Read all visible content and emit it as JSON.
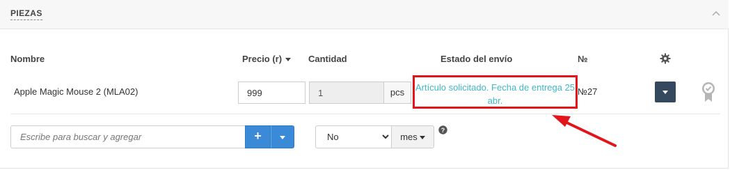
{
  "panel": {
    "title": "PIEZAS"
  },
  "table": {
    "headers": {
      "name": "Nombre",
      "price": "Precio (r)",
      "quantity": "Cantidad",
      "shipping_status": "Estado del envío",
      "number": "№"
    },
    "rows": [
      {
        "name": "Apple Magic Mouse 2 (MLA02)",
        "price": "999",
        "quantity": "1",
        "unit": "pcs",
        "shipping_status": "Artículo solicitado. Fecha de entrega 25 abr.",
        "number": "№27"
      }
    ]
  },
  "add_row": {
    "search_placeholder": "Escribe para buscar y agregar",
    "add_label": "+",
    "warranty_value": "No",
    "warranty_options": [
      "No"
    ],
    "period_label": "mes"
  },
  "colors": {
    "accent_blue": "#3a8ad8",
    "status_teal": "#3fb8c8",
    "highlight_red": "#e4141b",
    "dark_button": "#34495e"
  },
  "icons": [
    "chevron-up-icon",
    "gear-icon",
    "caret-down-icon",
    "plus-icon",
    "help-icon",
    "warranty-badge-icon",
    "arrow-annotation"
  ]
}
